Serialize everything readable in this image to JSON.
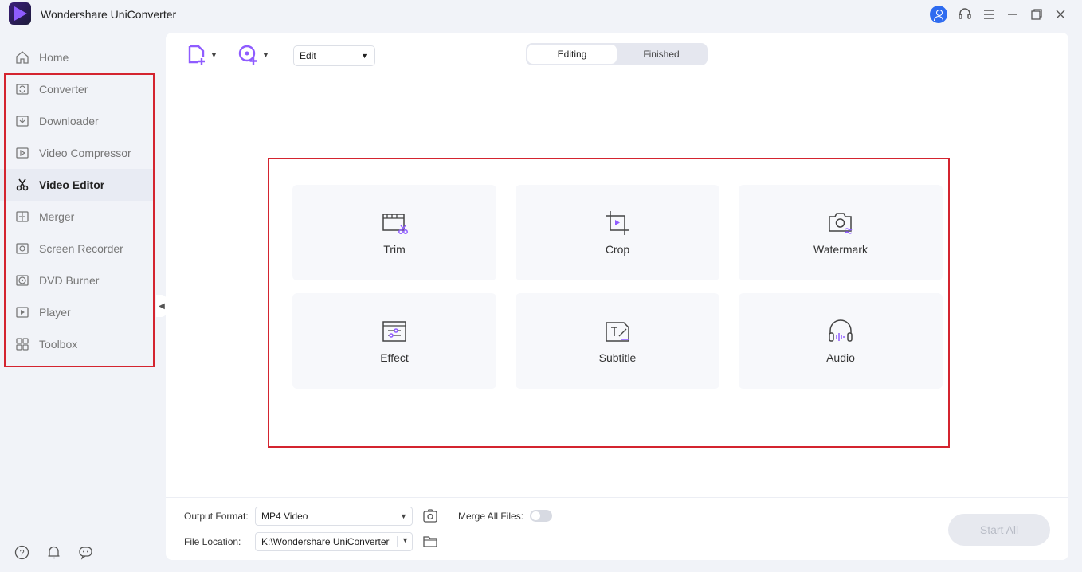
{
  "app": {
    "title": "Wondershare UniConverter"
  },
  "window_controls": [
    "account-icon",
    "support-icon",
    "menu-icon",
    "minimize-icon",
    "restore-icon",
    "close-icon"
  ],
  "sidebar": {
    "items": [
      {
        "label": "Home",
        "icon": "home-icon"
      },
      {
        "label": "Converter",
        "icon": "converter-icon"
      },
      {
        "label": "Downloader",
        "icon": "downloader-icon"
      },
      {
        "label": "Video Compressor",
        "icon": "compressor-icon"
      },
      {
        "label": "Video Editor",
        "icon": "scissors-icon",
        "active": true
      },
      {
        "label": "Merger",
        "icon": "merger-icon"
      },
      {
        "label": "Screen Recorder",
        "icon": "screen-recorder-icon"
      },
      {
        "label": "DVD Burner",
        "icon": "dvd-icon"
      },
      {
        "label": "Player",
        "icon": "player-icon"
      },
      {
        "label": "Toolbox",
        "icon": "toolbox-icon"
      }
    ],
    "bottom_icons": [
      "help-icon",
      "notification-icon",
      "feedback-icon"
    ]
  },
  "toolbar": {
    "edit_select": "Edit",
    "tabs": [
      {
        "label": "Editing",
        "active": true
      },
      {
        "label": "Finished",
        "active": false
      }
    ]
  },
  "tools": [
    {
      "label": "Trim",
      "icon": "trim-icon"
    },
    {
      "label": "Crop",
      "icon": "crop-icon"
    },
    {
      "label": "Watermark",
      "icon": "watermark-icon"
    },
    {
      "label": "Effect",
      "icon": "effect-icon"
    },
    {
      "label": "Subtitle",
      "icon": "subtitle-icon"
    },
    {
      "label": "Audio",
      "icon": "audio-icon"
    }
  ],
  "bottom": {
    "output_format_label": "Output Format:",
    "output_format_value": "MP4 Video",
    "merge_label": "Merge All Files:",
    "merge_enabled": false,
    "file_location_label": "File Location:",
    "file_location_value": "K:\\Wondershare UniConverter",
    "start_all_label": "Start All"
  },
  "colors": {
    "accent_purple": "#8f5cff",
    "highlight_red": "#d4242f",
    "account_blue": "#2e6bf0"
  }
}
